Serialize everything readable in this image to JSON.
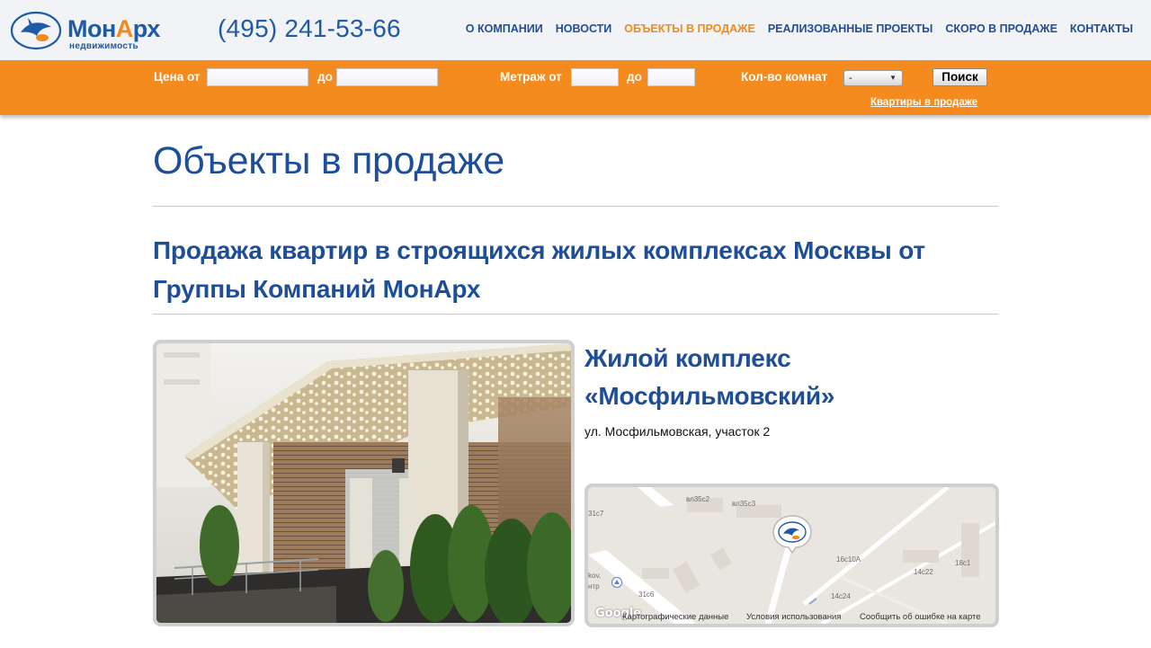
{
  "header": {
    "logo": {
      "name_main": "Мон",
      "name_accent": "А",
      "name_end": "рх",
      "sub": "недвижимость"
    },
    "phone": "(495) 241-53-66",
    "nav": [
      {
        "label": "О КОМПАНИИ",
        "active": false
      },
      {
        "label": "НОВОСТИ",
        "active": false
      },
      {
        "label": "ОБЪЕКТЫ В ПРОДАЖЕ",
        "active": true
      },
      {
        "label": "РЕАЛИЗОВАННЫЕ ПРОЕКТЫ",
        "active": false
      },
      {
        "label": "СКОРО В ПРОДАЖЕ",
        "active": false
      },
      {
        "label": "КОНТАКТЫ",
        "active": false
      }
    ]
  },
  "search": {
    "price_from_label": "Цена от",
    "price_to_label": "до",
    "price_from_value": "",
    "price_to_value": "",
    "area_from_label": "Метраж от",
    "area_to_label": "до",
    "area_from_value": "",
    "area_to_value": "",
    "rooms_label": "Кол-во комнат",
    "rooms_selected": "-",
    "button_label": "Поиск",
    "apartments_link": "Квартиры в продаже"
  },
  "main": {
    "page_title": "Объекты в продаже",
    "subtitle": "Продажа квартир в строящихся жилых комплексах Москвы от Группы Компаний МонАрх",
    "object": {
      "title": "Жилой комплекс «Мосфильмовский»",
      "address": "ул. Мосфильмовская, участок 2"
    },
    "map": {
      "labels": [
        "вл35с2",
        "вл35с3",
        "31с7",
        "16с10А",
        "18с1",
        "14с22",
        "14с24",
        "31с6",
        "kov,",
        "нтр"
      ],
      "google": "Google",
      "footer_data": "Картографические данные",
      "footer_terms": "Условия использования",
      "footer_report": "Сообщить об ошибке на карте"
    }
  },
  "colors": {
    "brand_blue": "#1f4e99",
    "brand_orange": "#f58a1f"
  }
}
